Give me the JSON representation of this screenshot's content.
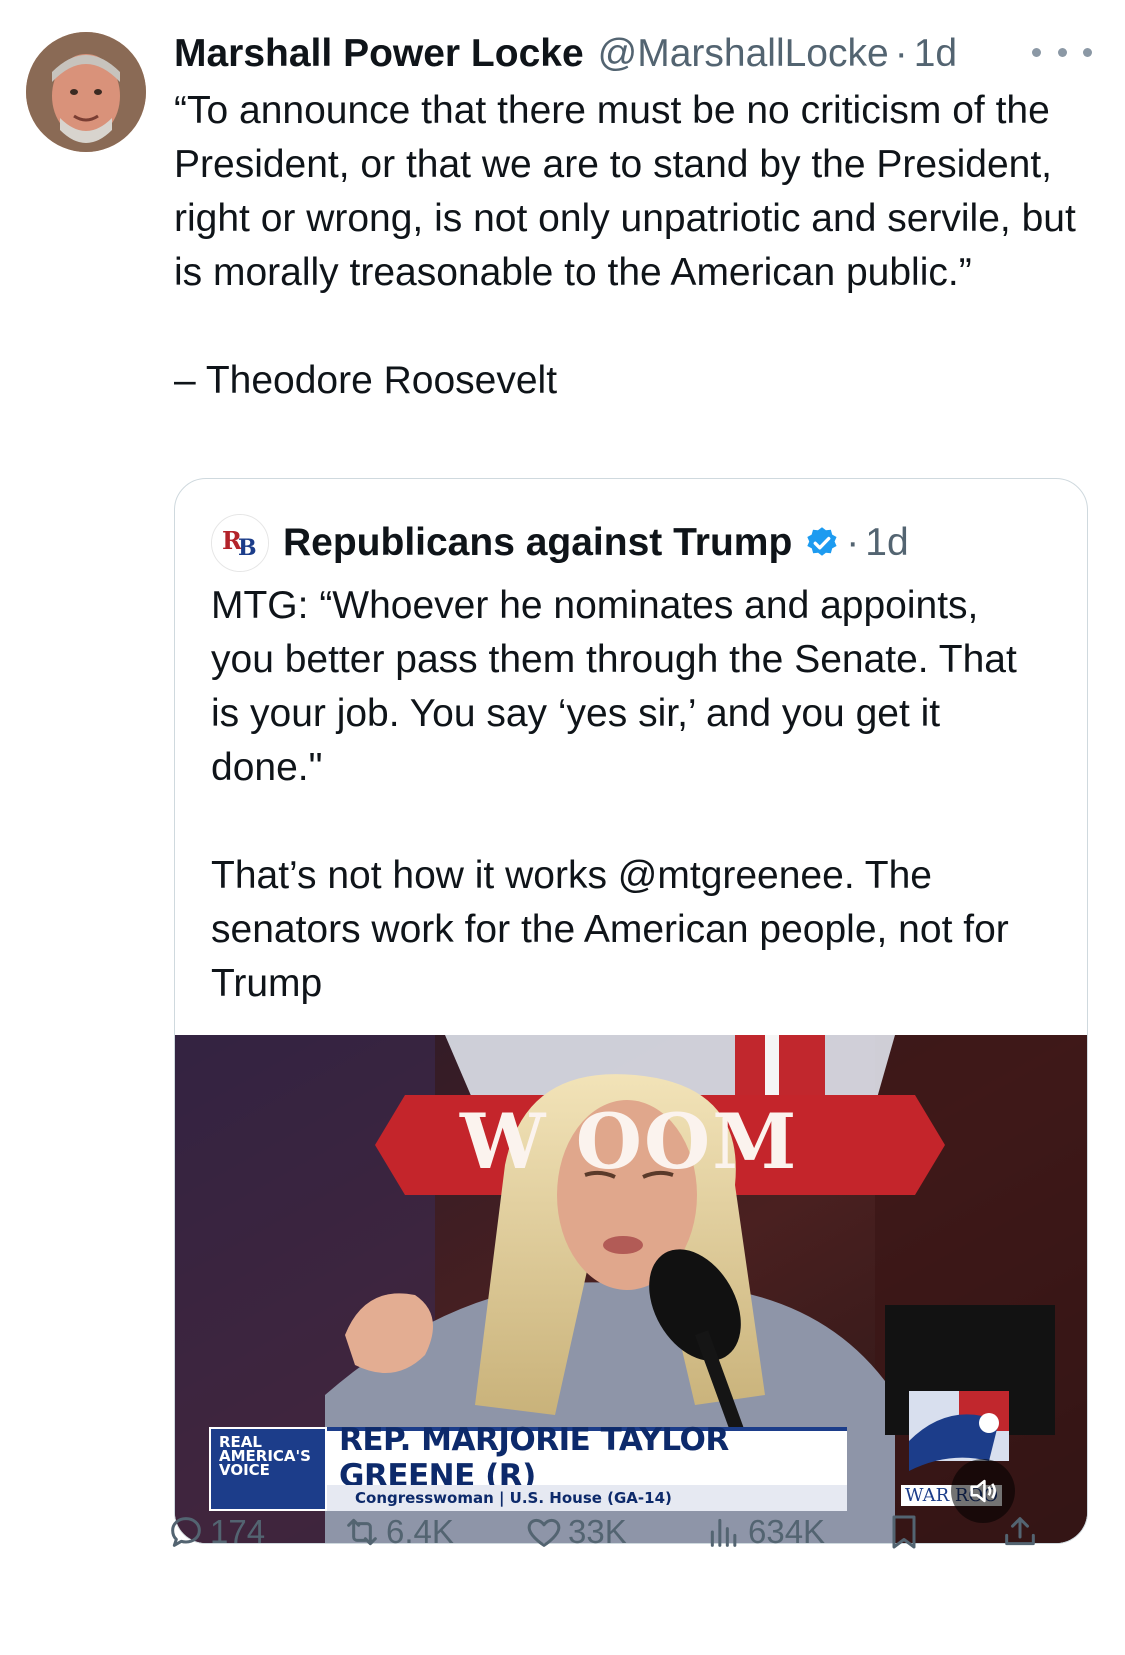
{
  "tweet": {
    "author_name": "Marshall Power Locke",
    "author_handle": "@MarshallLocke",
    "separator": "·",
    "time": "1d",
    "text": "“To announce that there must be no criticism of the President, or that we are to stand by the President, right or wrong, is not only unpatriotic and servile, but is morally treasonable to the American public.”\n\n– Theodore Roosevelt"
  },
  "quoted": {
    "author_name": "Republicans against Trump",
    "separator": "·",
    "time": "1d",
    "avatar_text": "RB",
    "text": "MTG: “Whoever he nominates and appoints, you better pass them through the Senate. That is your job. You say ‘yes sir,’ and you get it done.\"\n\nThat’s not how it works @mtgreenee. The senators work for the American people, not for Trump",
    "video": {
      "background_sign": "W    OOM",
      "brand": "REAL AMERICA'S VOICE",
      "chyron_name": "REP. MARJORIE TAYLOR GREENE (R)",
      "chyron_sub": "Congresswoman | U.S. House (GA-14)",
      "corner_logo": "WAR ROO"
    }
  },
  "actions": {
    "replies": "174",
    "reposts": "6.4K",
    "likes": "33K",
    "views": "634K"
  },
  "colors": {
    "text": "#0f1419",
    "secondary": "#536471",
    "verified": "#1d9bf0",
    "border": "#cfd9de"
  }
}
